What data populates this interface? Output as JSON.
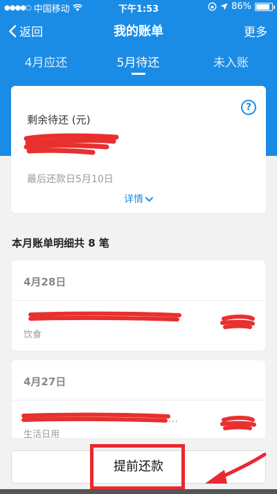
{
  "status_bar": {
    "carrier": "中国移动",
    "time": "下午1:53",
    "battery": "86%",
    "battery_level": 0.86
  },
  "nav": {
    "back_label": "返回",
    "title": "我的账单",
    "more_label": "更多"
  },
  "tabs": [
    {
      "label": "4月应还"
    },
    {
      "label": "5月待还",
      "active": true
    },
    {
      "label": "未入账"
    }
  ],
  "summary": {
    "label": "剩余待还 (元)",
    "help_symbol": "?",
    "due_text": "最后还款日5月10日",
    "detail_label": "详情"
  },
  "section": {
    "title": "本月账单明细共 8 笔"
  },
  "transactions": [
    {
      "date": "4月28日",
      "category": "饮食"
    },
    {
      "date": "4月27日",
      "category": "生活日用"
    }
  ],
  "bottom": {
    "repay_label": "提前还款"
  },
  "colors": {
    "brand_blue": "#1b8ce6",
    "annotation_red": "#e9292e"
  }
}
